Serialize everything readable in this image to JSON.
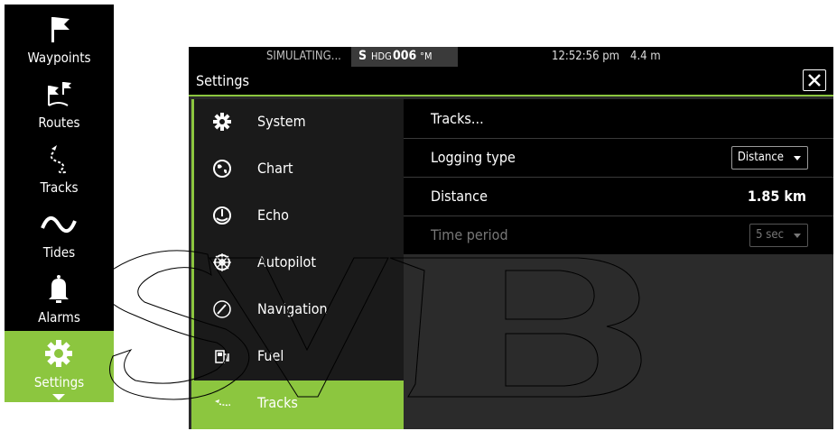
{
  "leftnav": {
    "items": [
      {
        "label": "Waypoints",
        "icon": "flag-icon"
      },
      {
        "label": "Routes",
        "icon": "route-flags-icon"
      },
      {
        "label": "Tracks",
        "icon": "track-icon"
      },
      {
        "label": "Tides",
        "icon": "wave-icon"
      },
      {
        "label": "Alarms",
        "icon": "bell-icon"
      },
      {
        "label": "Settings",
        "icon": "gear-icon"
      }
    ],
    "active_color": "#8cc63f"
  },
  "statusbar": {
    "simulating": "SIMULATING...",
    "heading_prefix": "S",
    "heading_label": "HDG",
    "heading_value": "006",
    "heading_unit": "°M",
    "time": "12:52:56 pm",
    "depth": "4.4 m"
  },
  "title": "Settings",
  "settings_list": [
    {
      "label": "System",
      "icon": "gear-icon"
    },
    {
      "label": "Chart",
      "icon": "globe-icon"
    },
    {
      "label": "Echo",
      "icon": "sonar-icon"
    },
    {
      "label": "Autopilot",
      "icon": "helm-icon"
    },
    {
      "label": "Navigation",
      "icon": "compass-icon"
    },
    {
      "label": "Fuel",
      "icon": "fuel-pump-icon"
    },
    {
      "label": "Tracks",
      "icon": "track-icon"
    }
  ],
  "details": {
    "header": "Tracks...",
    "logging_type_label": "Logging type",
    "logging_type_value": "Distance",
    "distance_label": "Distance",
    "distance_value": "1.85 km",
    "time_period_label": "Time period",
    "time_period_value": "5 sec"
  },
  "watermark": "SVB"
}
